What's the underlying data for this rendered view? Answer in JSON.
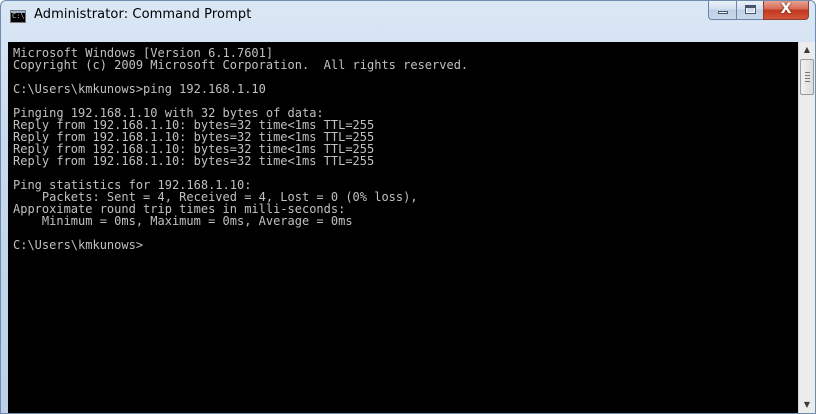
{
  "window": {
    "title": "Administrator: Command Prompt",
    "icon_name": "command-prompt-icon",
    "icon_text": "C:\\.",
    "controls": {
      "minimize": "minimize-icon",
      "maximize": "maximize-icon",
      "close": "close-icon",
      "close_glyph": "X"
    }
  },
  "console": {
    "background": "#000000",
    "foreground": "#c0c0c0",
    "lines": [
      "Microsoft Windows [Version 6.1.7601]",
      "Copyright (c) 2009 Microsoft Corporation.  All rights reserved.",
      "",
      "C:\\Users\\kmkunows>ping 192.168.1.10",
      "",
      "Pinging 192.168.1.10 with 32 bytes of data:",
      "Reply from 192.168.1.10: bytes=32 time<1ms TTL=255",
      "Reply from 192.168.1.10: bytes=32 time<1ms TTL=255",
      "Reply from 192.168.1.10: bytes=32 time<1ms TTL=255",
      "Reply from 192.168.1.10: bytes=32 time<1ms TTL=255",
      "",
      "Ping statistics for 192.168.1.10:",
      "    Packets: Sent = 4, Received = 4, Lost = 0 (0% loss),",
      "Approximate round trip times in milli-seconds:",
      "    Minimum = 0ms, Maximum = 0ms, Average = 0ms",
      "",
      "C:\\Users\\kmkunows>"
    ]
  },
  "scrollbar": {
    "up_arrow": "▲",
    "down_arrow": "▼"
  }
}
